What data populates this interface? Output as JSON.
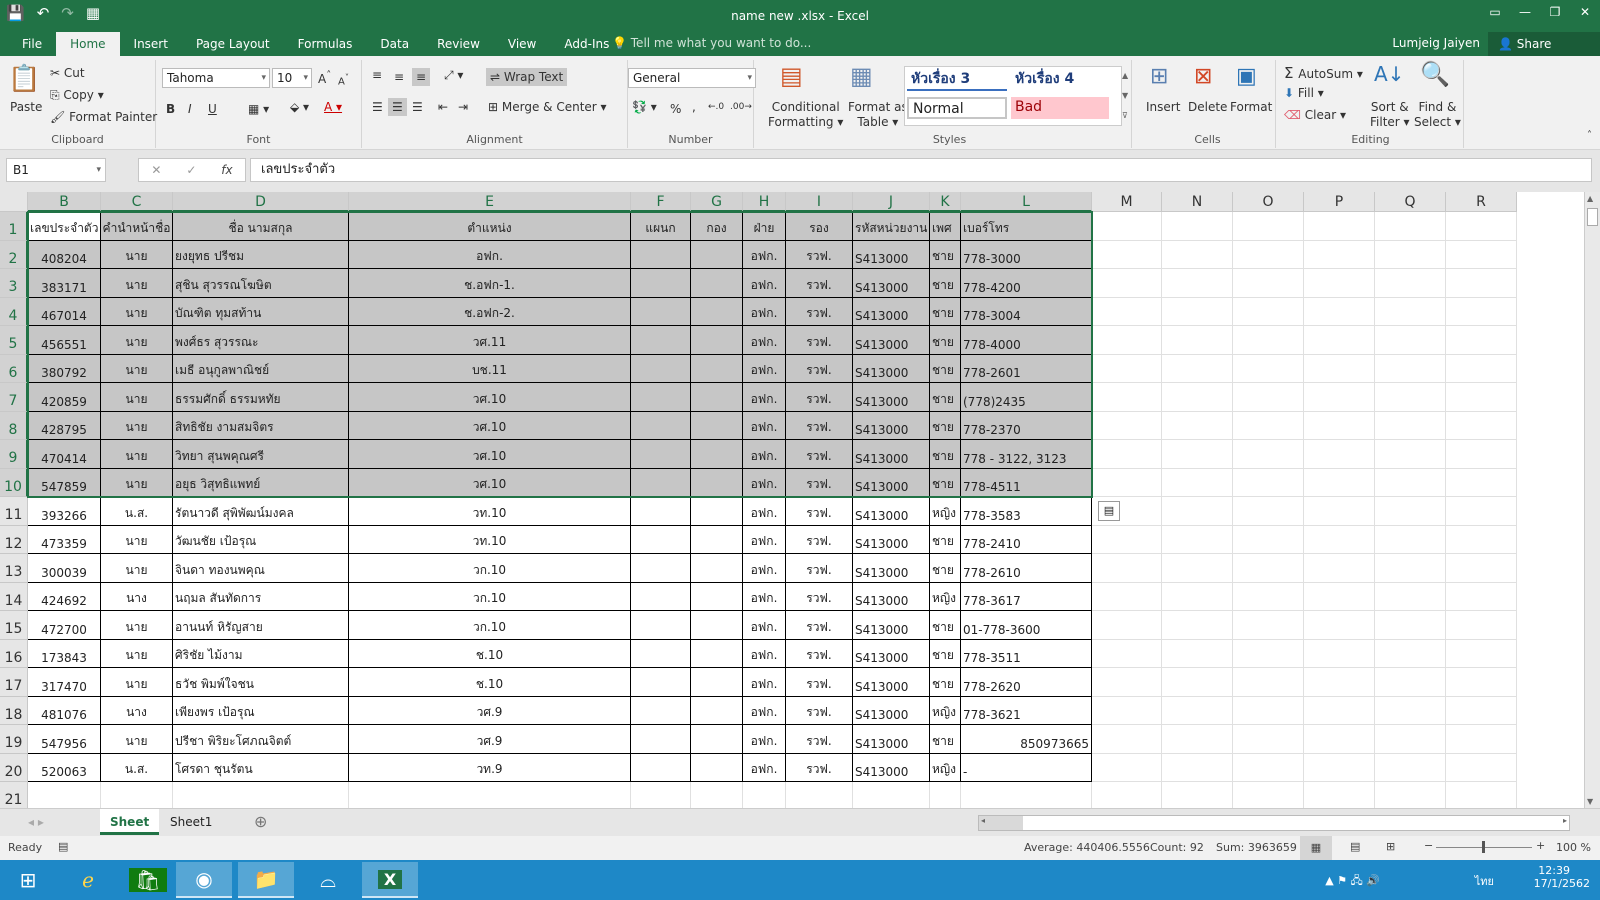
{
  "window": {
    "title": "name new .xlsx - Excel"
  },
  "qat": {
    "save_icon": "💾",
    "undo_icon": "↶",
    "redo_icon": "↷",
    "custom_icon": "▦"
  },
  "ribbon_tabs": [
    "File",
    "Home",
    "Insert",
    "Page Layout",
    "Formulas",
    "Data",
    "Review",
    "View",
    "Add-Ins"
  ],
  "active_tab": "Home",
  "tell_me": "Tell me what you want to do...",
  "user": "Lumjeig Jaiyen",
  "share_label": "Share",
  "clipboard": {
    "paste": "Paste",
    "cut": "Cut",
    "copy": "Copy",
    "format_painter": "Format Painter",
    "label": "Clipboard"
  },
  "font": {
    "name": "Tahoma",
    "size": "10",
    "bold": "B",
    "italic": "I",
    "underline": "U",
    "label": "Font"
  },
  "alignment": {
    "wrap_text": "Wrap Text",
    "merge_center": "Merge & Center",
    "label": "Alignment"
  },
  "number": {
    "format": "General",
    "percent": "%",
    "comma": ",",
    "label": "Number"
  },
  "styles": {
    "conditional": "Conditional",
    "conditional2": "Formatting",
    "format_table": "Format as",
    "format_table2": "Table",
    "heading3": "หัวเรื่อง 3",
    "heading4": "หัวเรื่อง 4",
    "normal": "Normal",
    "bad": "Bad",
    "label": "Styles"
  },
  "cells_group": {
    "insert": "Insert",
    "delete": "Delete",
    "format": "Format",
    "label": "Cells"
  },
  "editing": {
    "autosum": "AutoSum",
    "fill": "Fill",
    "clear": "Clear",
    "sort": "Sort &",
    "sort2": "Filter",
    "find": "Find &",
    "find2": "Select",
    "label": "Editing"
  },
  "formula_bar": {
    "name_box": "B1",
    "content": "เลขประจำตัว",
    "fx": "fx",
    "cancel": "✕",
    "enter": "✓"
  },
  "columns": [
    "B",
    "C",
    "D",
    "E",
    "F",
    "G",
    "H",
    "I",
    "J",
    "K",
    "L",
    "M",
    "N",
    "O",
    "P",
    "Q",
    "R"
  ],
  "headers": [
    "เลขประจำตัว",
    "คำนำหน้าชื่อ",
    "ชื่อ นามสกุล",
    "ตำแหน่ง",
    "แผนก",
    "กอง",
    "ฝ่าย",
    "รอง",
    "รหัสหน่วยงาน",
    "เพศ",
    "เบอร์โทร"
  ],
  "rows": [
    [
      "408204",
      "นาย",
      "ยงยุทธ ปรีชม",
      "อฟก.",
      "",
      "",
      "อฟก.",
      "รวฟ.",
      "S413000",
      "ชาย",
      "778-3000"
    ],
    [
      "383171",
      "นาย",
      "สุชิน สุวรรณโฆษิต",
      "ช.อฟก-1.",
      "",
      "",
      "อฟก.",
      "รวฟ.",
      "S413000",
      "ชาย",
      "778-4200"
    ],
    [
      "467014",
      "นาย",
      "บัณฑิต ทุมสท้าน",
      "ช.อฟก-2.",
      "",
      "",
      "อฟก.",
      "รวฟ.",
      "S413000",
      "ชาย",
      "778-3004"
    ],
    [
      "456551",
      "นาย",
      "พงศ์ธร สุวรรณะ",
      "วศ.11",
      "",
      "",
      "อฟก.",
      "รวฟ.",
      "S413000",
      "ชาย",
      "778-4000"
    ],
    [
      "380792",
      "นาย",
      "เมธี อนุกูลพาณิชย์",
      "บช.11",
      "",
      "",
      "อฟก.",
      "รวฟ.",
      "S413000",
      "ชาย",
      "778-2601"
    ],
    [
      "420859",
      "นาย",
      "ธรรมศักดิ์ ธรรมหทัย",
      "วศ.10",
      "",
      "",
      "อฟก.",
      "รวฟ.",
      "S413000",
      "ชาย",
      "(778)2435"
    ],
    [
      "428795",
      "นาย",
      "สิทธิชัย งามสมจิตร",
      "วศ.10",
      "",
      "",
      "อฟก.",
      "รวฟ.",
      "S413000",
      "ชาย",
      "778-2370"
    ],
    [
      "470414",
      "นาย",
      "วิทยา สุนพคุณศรี",
      "วศ.10",
      "",
      "",
      "อฟก.",
      "รวฟ.",
      "S413000",
      "ชาย",
      "778 - 3122, 3123"
    ],
    [
      "547859",
      "นาย",
      "อยุธ วิสุทธิแพทย์",
      "วศ.10",
      "",
      "",
      "อฟก.",
      "รวฟ.",
      "S413000",
      "ชาย",
      "778-4511"
    ],
    [
      "393266",
      "น.ส.",
      "รัตนาวดี สุพิพัฒน์มงคล",
      "วท.10",
      "",
      "",
      "อฟก.",
      "รวฟ.",
      "S413000",
      "หญิง",
      "778-3583"
    ],
    [
      "473359",
      "นาย",
      "วัฒนชัย เป้อรุณ",
      "วท.10",
      "",
      "",
      "อฟก.",
      "รวฟ.",
      "S413000",
      "ชาย",
      "778-2410"
    ],
    [
      "300039",
      "นาย",
      "จินดา ทองนพคุณ",
      "วก.10",
      "",
      "",
      "อฟก.",
      "รวฟ.",
      "S413000",
      "ชาย",
      "778-2610"
    ],
    [
      "424692",
      "นาง",
      "นฤมล สันทัดการ",
      "วก.10",
      "",
      "",
      "อฟก.",
      "รวฟ.",
      "S413000",
      "หญิง",
      "778-3617"
    ],
    [
      "472700",
      "นาย",
      "อานนท์ หิรัญสาย",
      "วก.10",
      "",
      "",
      "อฟก.",
      "รวฟ.",
      "S413000",
      "ชาย",
      "01-778-3600"
    ],
    [
      "173843",
      "นาย",
      "ศิริชัย ไม้งาม",
      "ช.10",
      "",
      "",
      "อฟก.",
      "รวฟ.",
      "S413000",
      "ชาย",
      "778-3511"
    ],
    [
      "317470",
      "นาย",
      "ธวัช พิมพ์ใจชน",
      "ช.10",
      "",
      "",
      "อฟก.",
      "รวฟ.",
      "S413000",
      "ชาย",
      "778-2620"
    ],
    [
      "481076",
      "นาง",
      "เพียงพร เป้อรุณ",
      "วศ.9",
      "",
      "",
      "อฟก.",
      "รวฟ.",
      "S413000",
      "หญิง",
      "778-3621"
    ],
    [
      "547956",
      "นาย",
      "ปรีชา พิริยะโศภณจิตต์",
      "วศ.9",
      "",
      "",
      "อฟก.",
      "รวฟ.",
      "S413000",
      "ชาย",
      "850973665"
    ],
    [
      "520063",
      "น.ส.",
      "โศรดา ชุนรัตน",
      "วท.9",
      "",
      "",
      "อฟก.",
      "รวฟ.",
      "S413000",
      "หญิง",
      "-"
    ]
  ],
  "sheets": [
    "Sheet",
    "Sheet1"
  ],
  "active_sheet": "Sheet",
  "status": {
    "ready": "Ready",
    "average": "Average: 440406.5556",
    "count": "Count: 92",
    "sum": "Sum: 3963659",
    "zoom": "100 %"
  },
  "taskbar": {
    "time": "12:39",
    "date": "17/1/2562",
    "lang": "ไทย"
  }
}
